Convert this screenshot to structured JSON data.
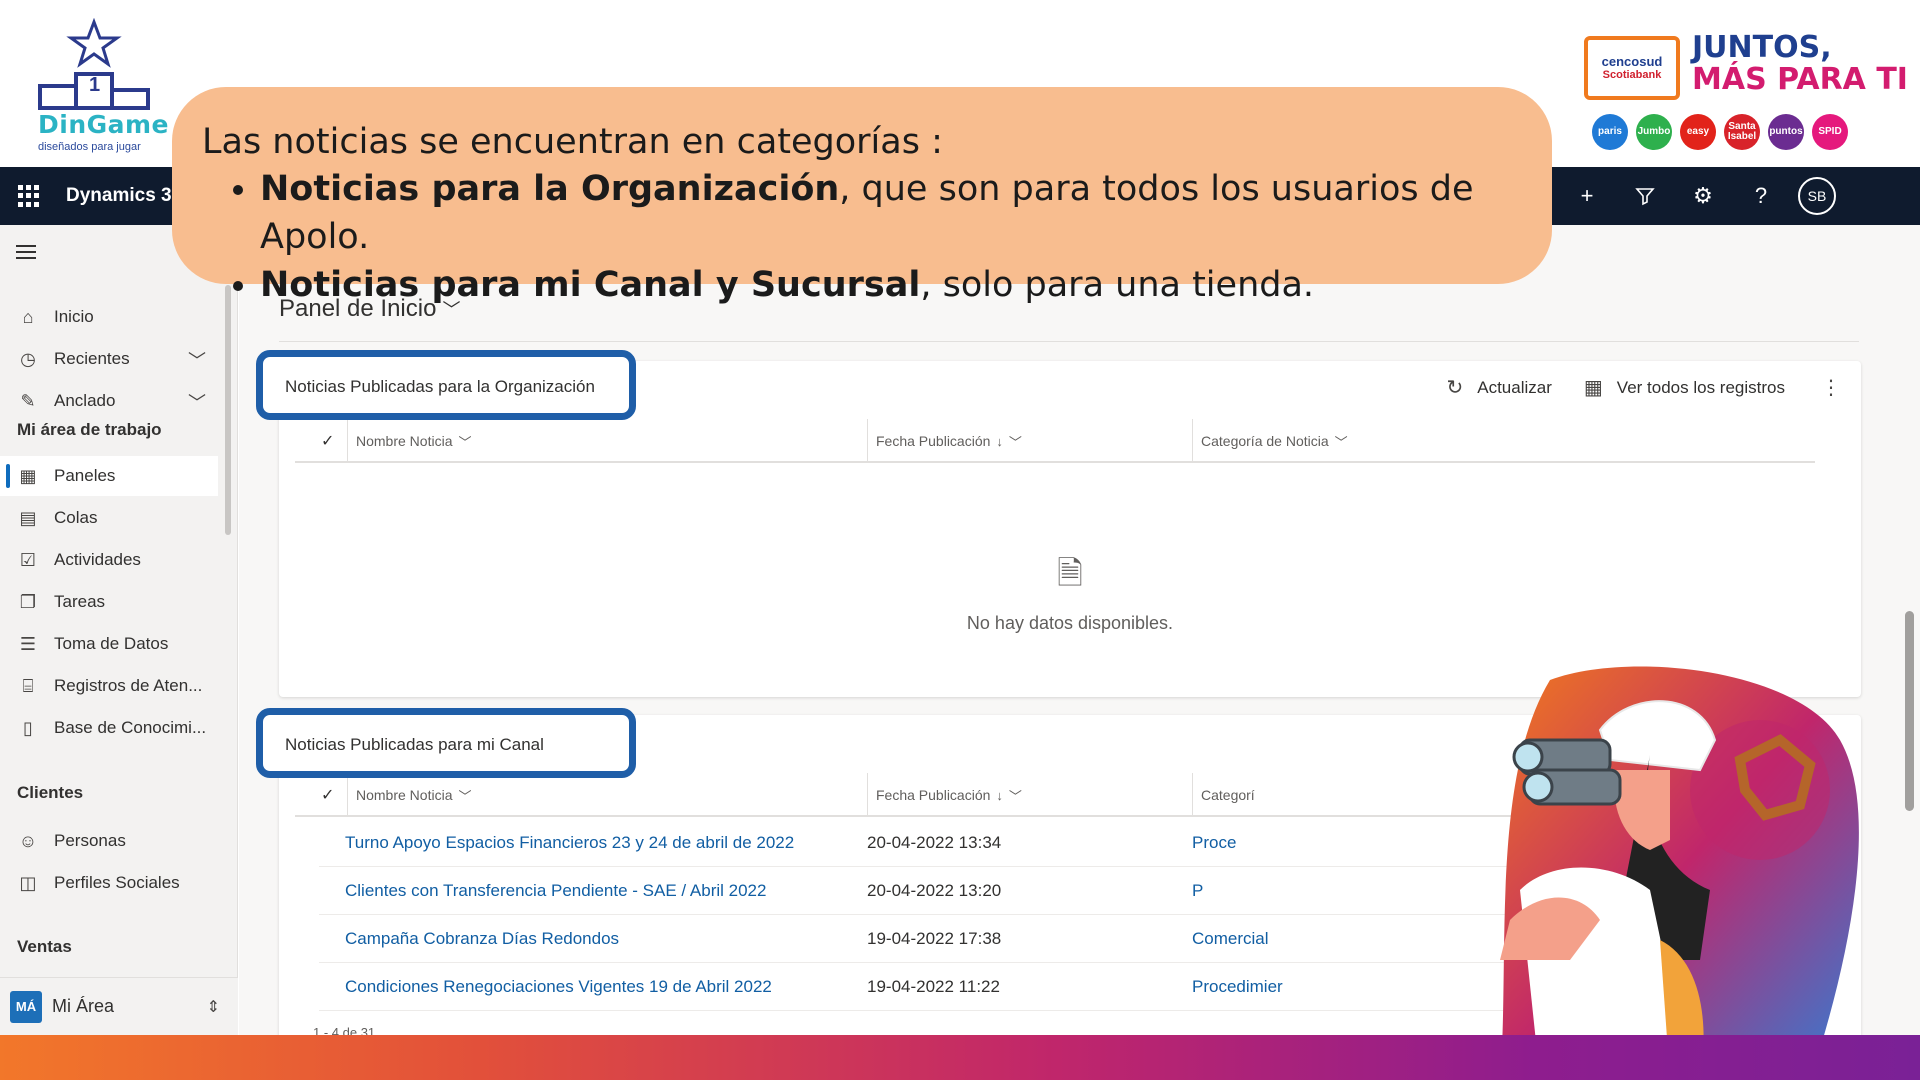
{
  "brand": {
    "left_name": "DinGame",
    "left_tagline": "diseñados para jugar",
    "podium_number": "1",
    "partner_line1": "cencosud",
    "partner_line2": "Scotiabank",
    "slogan_line1": "JUNTOS,",
    "slogan_line2": "MÁS PARA TI",
    "stores": [
      {
        "label": "paris",
        "color": "#1f7ad6"
      },
      {
        "label": "Jumbo",
        "color": "#2eb04d"
      },
      {
        "label": "easy",
        "color": "#e2231a"
      },
      {
        "label": "Santa Isabel",
        "color": "#d8232a"
      },
      {
        "label": "puntos",
        "color": "#6b2c91"
      },
      {
        "label": "SPID",
        "color": "#e5197d"
      }
    ]
  },
  "callout": {
    "intro": "Las noticias se encuentran en categorías :",
    "bullets": [
      {
        "bold": "Noticias para la Organización",
        "rest": ", que son para todos los usuarios de Apolo."
      },
      {
        "bold": "Noticias para mi Canal y Sucursal",
        "rest": ", solo para una tienda."
      }
    ]
  },
  "topbar": {
    "app_title": "Dynamics 36",
    "icons": [
      "lightbulb-icon",
      "plus-icon",
      "filter-icon",
      "gear-icon",
      "help-icon"
    ],
    "avatar_initials": "SB"
  },
  "sidebar": {
    "items": [
      {
        "label": "Inicio",
        "icon": "home-icon"
      },
      {
        "label": "Recientes",
        "icon": "clock-icon"
      },
      {
        "label": "Anclado",
        "icon": "pin-icon"
      }
    ],
    "group_workspace": "Mi área de trabajo",
    "workspace_items": [
      {
        "label": "Paneles",
        "icon": "dashboard-icon"
      },
      {
        "label": "Colas",
        "icon": "queue-icon"
      },
      {
        "label": "Actividades",
        "icon": "activities-icon"
      },
      {
        "label": "Tareas",
        "icon": "tasks-icon"
      },
      {
        "label": "Toma de Datos",
        "icon": "data-icon"
      },
      {
        "label": "Registros de Aten...",
        "icon": "records-icon"
      },
      {
        "label": "Base de Conocimi...",
        "icon": "book-icon"
      }
    ],
    "group_clients": "Clientes",
    "client_items": [
      {
        "label": "Personas",
        "icon": "person-icon"
      },
      {
        "label": "Perfiles Sociales",
        "icon": "social-profile-icon"
      }
    ],
    "group_sales": "Ventas",
    "area_badge": "MÁ",
    "area_label": "Mi Área"
  },
  "main": {
    "panel_title": "Panel de Inicio",
    "card1": {
      "title": "Noticias Publicadas para la Organización",
      "refresh_label": "Actualizar",
      "view_all_label": "Ver todos los registros",
      "columns": [
        "Nombre Noticia",
        "Fecha Publicación",
        "Categoría de Noticia"
      ],
      "empty_text": "No hay datos disponibles."
    },
    "card2": {
      "title": "Noticias Publicadas para mi Canal",
      "columns": [
        "Nombre Noticia",
        "Fecha Publicación",
        "Categorí"
      ],
      "rows": [
        {
          "name": "Turno Apoyo Espacios Financieros 23 y 24 de abril de 2022",
          "date": "20-04-2022 13:34",
          "category": "Proce"
        },
        {
          "name": "Clientes con Transferencia Pendiente - SAE / Abril 2022",
          "date": "20-04-2022 13:20",
          "category": "P"
        },
        {
          "name": "Campaña Cobranza Días Redondos",
          "date": "19-04-2022 17:38",
          "category": "Comercial"
        },
        {
          "name": "Condiciones Renegociaciones Vigentes 19 de Abril 2022",
          "date": "19-04-2022 11:22",
          "category": "Procedimier"
        }
      ],
      "pager": "1 - 4 de 31"
    }
  },
  "colors": {
    "highlight_border": "#1f5ea8",
    "callout_bg": "#f8bd8f",
    "topbar_bg": "#0f1b2e",
    "link": "#115ea3"
  }
}
